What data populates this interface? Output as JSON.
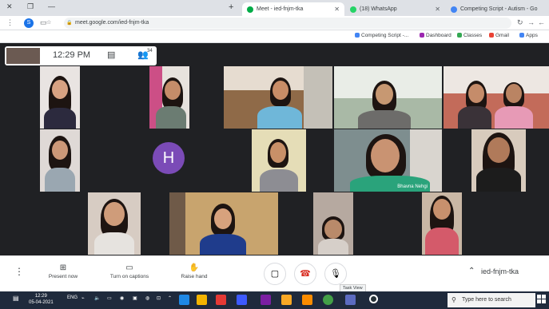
{
  "browser": {
    "tabs": [
      {
        "title": "Competing Script - Autism - Go",
        "favicon_color": "#4285f4"
      },
      {
        "title": "(18) WhatsApp",
        "favicon_color": "#25d366"
      },
      {
        "title": "Meet - ied-fnjm-tka",
        "favicon_color": "#00ac47"
      }
    ],
    "url": "meet.google.com/ied-fnjm-tka",
    "profile_initial": "S",
    "bookmarks": [
      {
        "label": "Apps",
        "color": "#4285f4"
      },
      {
        "label": "Gmail",
        "color": "#ea4335"
      },
      {
        "label": "Classes",
        "color": "#34a853"
      },
      {
        "label": "Dashboard",
        "color": "#9c27b0"
      },
      {
        "label": "Competing Script -...",
        "color": "#4285f4"
      }
    ]
  },
  "meet": {
    "time": "12:29 PM",
    "people_count": "34",
    "avatar_initial": "H",
    "avatar_color": "#7b4bb7",
    "caption_name": "Bhavna Nehgi",
    "meeting_code": "ied-fnjm-tka",
    "controls": {
      "present_now": "Present now",
      "captions": "Turn on captions",
      "raise_hand": "Raise hand",
      "tooltip": "Task View"
    }
  },
  "taskbar": {
    "search_placeholder": "Type here to search",
    "time": "12:29",
    "date": "05-04-2021",
    "lang": "ENG"
  }
}
